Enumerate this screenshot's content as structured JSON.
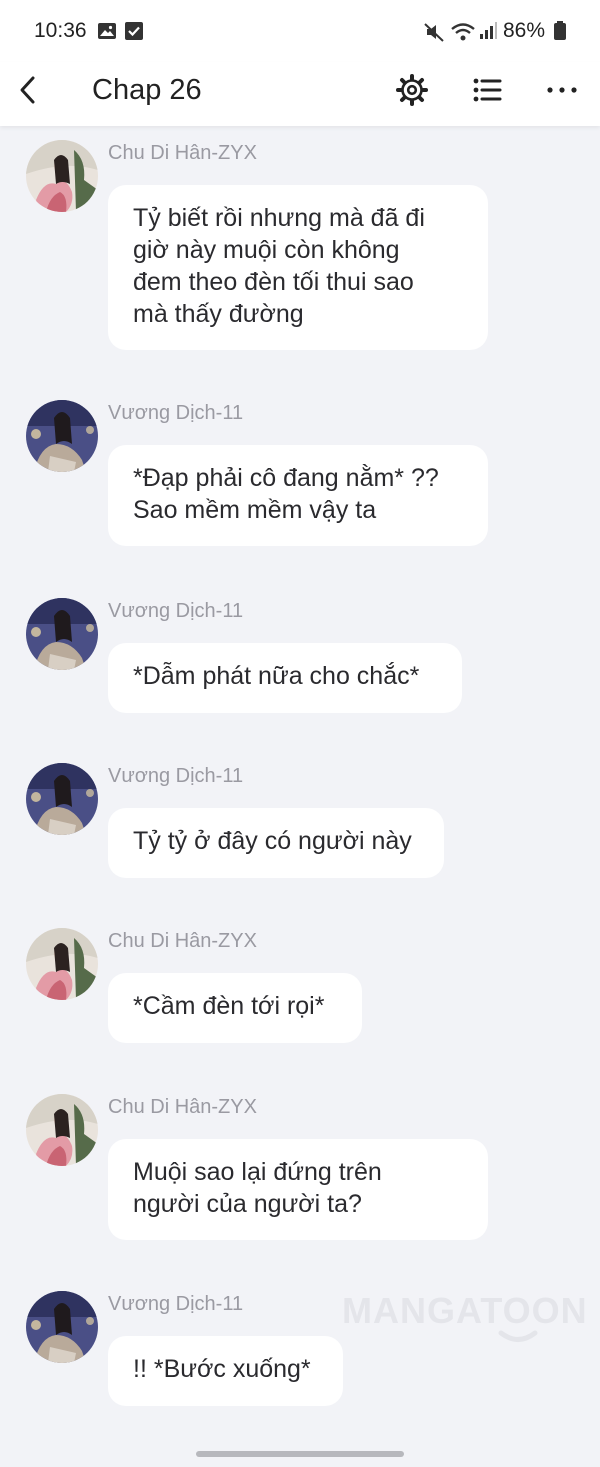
{
  "status_bar": {
    "time": "10:36",
    "battery": "86%",
    "icons": [
      "gallery-icon",
      "check-square-icon",
      "mute-icon",
      "wifi-icon",
      "signal-icon",
      "battery-icon"
    ]
  },
  "app_bar": {
    "title": "Chap 26",
    "icons": [
      "back-icon",
      "gear-icon",
      "list-icon",
      "more-icon"
    ]
  },
  "messages": [
    {
      "sender": "Chu Di Hân-ZYX",
      "avatar": "avatar-chu-di-han",
      "text": "Tỷ biết rồi nhưng mà đã đi\ngiờ này muội còn không\nđem theo đèn tối thui sao\nmà thấy đường"
    },
    {
      "sender": "Vương Dịch-11",
      "avatar": "avatar-vuong-dich",
      "text": "*Đạp phải cô đang nằm* ??\nSao mềm mềm vậy ta"
    },
    {
      "sender": "Vương Dịch-11",
      "avatar": "avatar-vuong-dich",
      "text": "*Dẫm phát nữa cho chắc*"
    },
    {
      "sender": "Vương Dịch-11",
      "avatar": "avatar-vuong-dich",
      "text": "Tỷ tỷ ở đây có người này"
    },
    {
      "sender": "Chu Di Hân-ZYX",
      "avatar": "avatar-chu-di-han",
      "text": "*Cầm đèn tới rọi*"
    },
    {
      "sender": "Chu Di Hân-ZYX",
      "avatar": "avatar-chu-di-han",
      "text": "Muội sao lại đứng trên\nngười của người ta?"
    },
    {
      "sender": "Vương Dịch-11",
      "avatar": "avatar-vuong-dich",
      "text": "!! *Bước xuống*"
    }
  ],
  "watermark": "MANGATOON",
  "colors": {
    "background": "#f2f3f7",
    "bubble": "#ffffff",
    "sender_name": "#9a9aa2",
    "text": "#2a2a2e"
  }
}
